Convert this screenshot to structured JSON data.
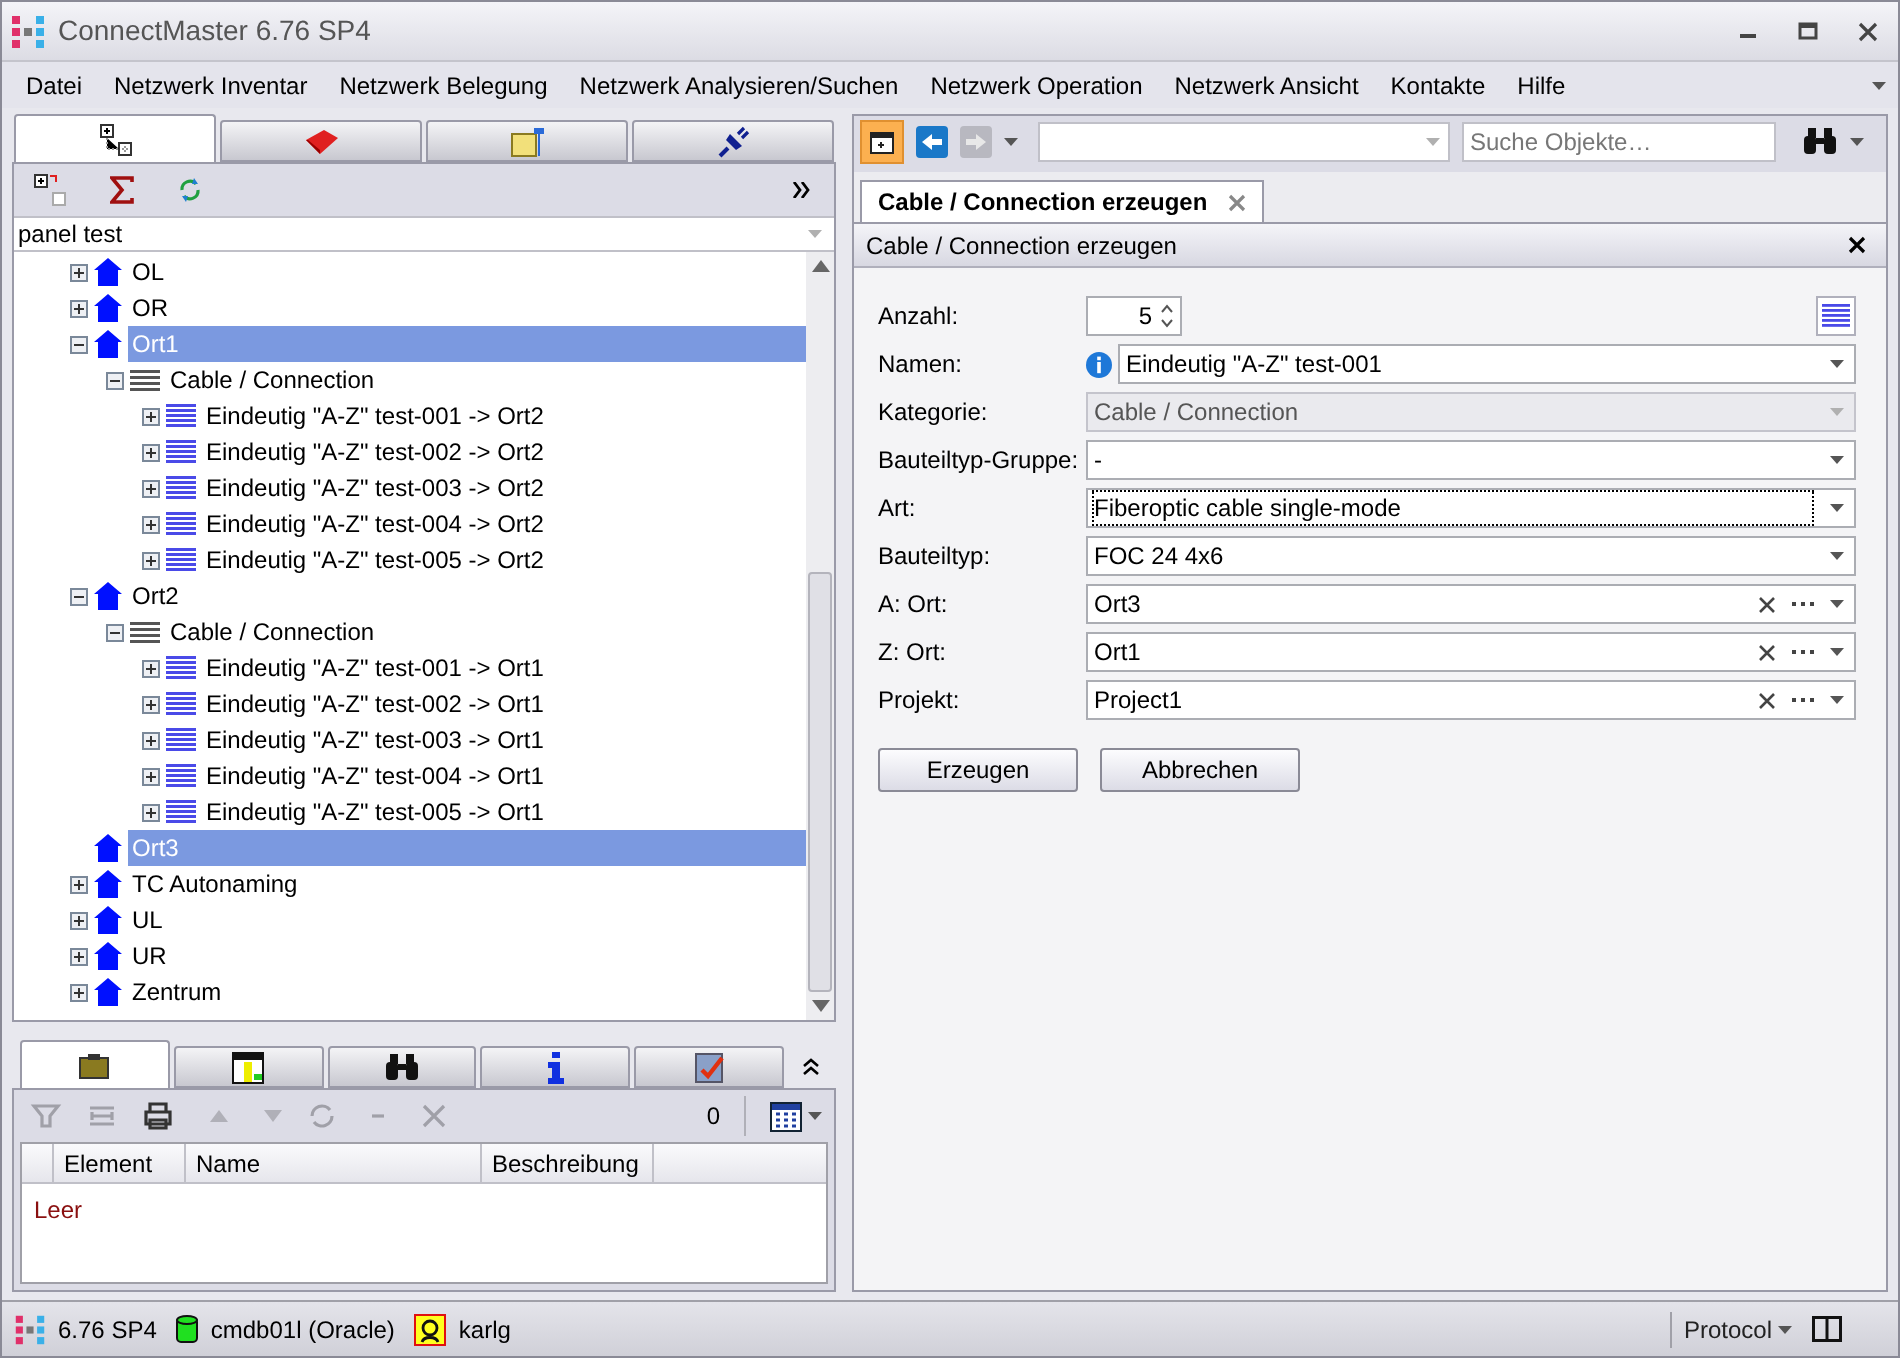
{
  "window": {
    "title": "ConnectMaster 6.76 SP4"
  },
  "menu": [
    "Datei",
    "Netzwerk Inventar",
    "Netzwerk Belegung",
    "Netzwerk Analysieren/Suchen",
    "Netzwerk Operation",
    "Netzwerk Ansicht",
    "Kontakte",
    "Hilfe"
  ],
  "left_panel": {
    "tabs": [
      {
        "selected": true
      },
      {
        "selected": false
      },
      {
        "selected": false
      },
      {
        "selected": false
      }
    ],
    "filter": {
      "value": "panel test"
    },
    "tree": [
      {
        "label": "OL",
        "kind": "location",
        "expanded": false,
        "selected": false
      },
      {
        "label": "OR",
        "kind": "location",
        "expanded": false,
        "selected": false
      },
      {
        "label": "Ort1",
        "kind": "location",
        "expanded": true,
        "selected": true,
        "children": [
          {
            "label": "Cable / Connection",
            "kind": "group",
            "expanded": true,
            "selected": false,
            "children": [
              {
                "label": "Eindeutig \"A-Z\" test-001 -> Ort2",
                "kind": "cable",
                "expanded": false,
                "selected": false
              },
              {
                "label": "Eindeutig \"A-Z\" test-002 -> Ort2",
                "kind": "cable",
                "expanded": false,
                "selected": false
              },
              {
                "label": "Eindeutig \"A-Z\" test-003 -> Ort2",
                "kind": "cable",
                "expanded": false,
                "selected": false
              },
              {
                "label": "Eindeutig \"A-Z\" test-004 -> Ort2",
                "kind": "cable",
                "expanded": false,
                "selected": false
              },
              {
                "label": "Eindeutig \"A-Z\" test-005 -> Ort2",
                "kind": "cable",
                "expanded": false,
                "selected": false
              }
            ]
          }
        ]
      },
      {
        "label": "Ort2",
        "kind": "location",
        "expanded": true,
        "selected": false,
        "children": [
          {
            "label": "Cable / Connection",
            "kind": "group",
            "expanded": true,
            "selected": false,
            "children": [
              {
                "label": "Eindeutig \"A-Z\" test-001 -> Ort1",
                "kind": "cable",
                "expanded": false,
                "selected": false
              },
              {
                "label": "Eindeutig \"A-Z\" test-002 -> Ort1",
                "kind": "cable",
                "expanded": false,
                "selected": false
              },
              {
                "label": "Eindeutig \"A-Z\" test-003 -> Ort1",
                "kind": "cable",
                "expanded": false,
                "selected": false
              },
              {
                "label": "Eindeutig \"A-Z\" test-004 -> Ort1",
                "kind": "cable",
                "expanded": false,
                "selected": false
              },
              {
                "label": "Eindeutig \"A-Z\" test-005 -> Ort1",
                "kind": "cable",
                "expanded": false,
                "selected": false
              }
            ]
          }
        ]
      },
      {
        "label": "Ort3",
        "kind": "location",
        "selected": true
      },
      {
        "label": "TC Autonaming",
        "kind": "location",
        "expanded": false,
        "selected": false
      },
      {
        "label": "UL",
        "kind": "location",
        "expanded": false,
        "selected": false
      },
      {
        "label": "UR",
        "kind": "location",
        "expanded": false,
        "selected": false
      },
      {
        "label": "Zentrum",
        "kind": "location",
        "expanded": false,
        "selected": false
      }
    ]
  },
  "bottom_panel": {
    "tabs": [
      {
        "selected": true
      },
      {
        "selected": false
      },
      {
        "selected": false
      },
      {
        "selected": false
      },
      {
        "selected": false
      }
    ],
    "count": "0",
    "table": {
      "columns": [
        "Element",
        "Name",
        "Beschreibung"
      ],
      "empty_text": "Leer"
    }
  },
  "right_panel": {
    "search": {
      "placeholder": "Suche Objekte…"
    },
    "doc_tab": {
      "label": "Cable / Connection erzeugen",
      "selected": true
    },
    "form": {
      "title": "Cable / Connection erzeugen",
      "fields": [
        {
          "label": "Anzahl:",
          "kind": "spin",
          "value": "5"
        },
        {
          "label": "Namen:",
          "kind": "combo",
          "value": "Eindeutig \"A-Z\" test-001",
          "info": true,
          "disabled": false,
          "focused": false
        },
        {
          "label": "Kategorie:",
          "kind": "combo",
          "value": "Cable / Connection",
          "disabled": true,
          "focused": false
        },
        {
          "label": "Bauteiltyp-Gruppe:",
          "kind": "combo",
          "value": "-",
          "disabled": false,
          "focused": false
        },
        {
          "label": "Art:",
          "kind": "combo",
          "value": "Fiberoptic cable single-mode",
          "disabled": false,
          "focused": true
        },
        {
          "label": "Bauteiltyp:",
          "kind": "combo",
          "value": "FOC 24 4x6",
          "disabled": false,
          "focused": false
        },
        {
          "label": "A: Ort:",
          "kind": "lookup",
          "value": "Ort3",
          "disabled": false,
          "focused": false
        },
        {
          "label": "Z: Ort:",
          "kind": "lookup",
          "value": "Ort1",
          "disabled": false,
          "focused": false
        },
        {
          "label": "Projekt:",
          "kind": "lookup",
          "value": "Project1",
          "disabled": false,
          "focused": false
        }
      ],
      "buttons": [
        "Erzeugen",
        "Abbrechen"
      ]
    }
  },
  "status_bar": {
    "version": "6.76 SP4",
    "database": "cmdb01l (Oracle)",
    "user": "karlg",
    "protocol": "Protocol"
  }
}
